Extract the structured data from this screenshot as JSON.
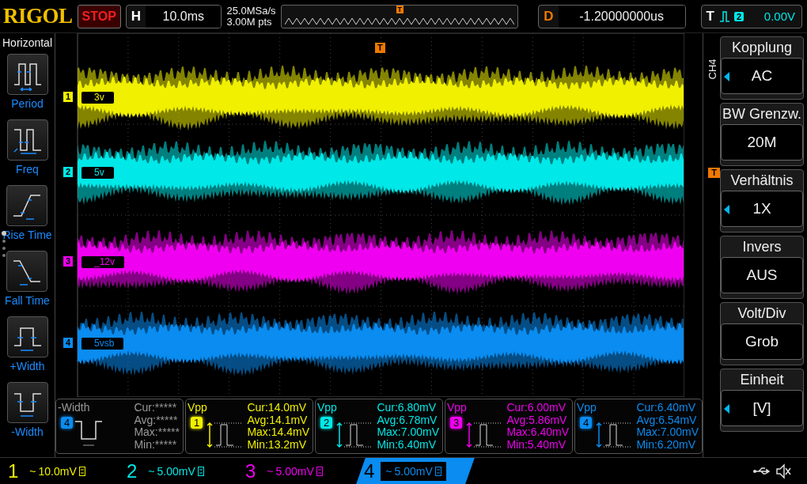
{
  "header": {
    "brand": "RIGOL",
    "run_state": "STOP",
    "timebase": {
      "label": "H",
      "value": "10.0ms"
    },
    "sample_rate": "25.0MSa/s",
    "memory_depth": "3.00M pts",
    "position_marker": "T",
    "delay": {
      "label": "D",
      "value": "-1.20000000us"
    },
    "trigger": {
      "label": "T",
      "source": "2",
      "level": "0.00V"
    }
  },
  "left_menu": {
    "title": "Horizontal",
    "items": [
      {
        "label": "Period",
        "kind": "period"
      },
      {
        "label": "Freq",
        "kind": "freq"
      },
      {
        "label": "Rise Time",
        "kind": "rise"
      },
      {
        "label": "Fall Time",
        "kind": "fall"
      },
      {
        "label": "+Width",
        "kind": "pwidth"
      },
      {
        "label": "-Width",
        "kind": "nwidth"
      }
    ]
  },
  "scope": {
    "trigger_position_marker": "T",
    "trigger_level_marker": "T",
    "channels": [
      {
        "number": "1",
        "label": "3v",
        "color": "#f0f000"
      },
      {
        "number": "2",
        "label": "5v",
        "color": "#00e8e8"
      },
      {
        "number": "3",
        "label": "_12v",
        "color": "#f000f0"
      },
      {
        "number": "4",
        "label": "5vsb",
        "color": "#0a8cf0"
      }
    ]
  },
  "right_menu": {
    "channel": "CH4",
    "items": [
      {
        "title": "Kopplung",
        "value": "AC",
        "arrow": true
      },
      {
        "title": "BW Grenzw.",
        "value": "20M",
        "arrow": false
      },
      {
        "title": "Verhältnis",
        "value": "1X",
        "arrow": true
      },
      {
        "title": "Invers",
        "value": "AUS",
        "arrow": false
      },
      {
        "title": "Volt/Div",
        "value": "Grob",
        "arrow": false
      },
      {
        "title": "Einheit",
        "value": "[V]",
        "arrow": true
      }
    ]
  },
  "measurements": [
    {
      "kind": "width",
      "title": "-Width",
      "channel": "4",
      "color": "#0a8cf0",
      "lines": [
        "Cur:*****",
        "Avg:*****",
        "Max:*****",
        "Min:*****"
      ]
    },
    {
      "kind": "vpp",
      "title": "Vpp",
      "channel": "1",
      "color": "#f0f000",
      "lines": [
        "Cur:14.0mV",
        "Avg:14.1mV",
        "Max:14.4mV",
        "Min:13.2mV"
      ]
    },
    {
      "kind": "vpp",
      "title": "Vpp",
      "channel": "2",
      "color": "#00e8e8",
      "lines": [
        "Cur:6.80mV",
        "Avg:6.78mV",
        "Max:7.00mV",
        "Min:6.40mV"
      ]
    },
    {
      "kind": "vpp",
      "title": "Vpp",
      "channel": "3",
      "color": "#f000f0",
      "lines": [
        "Cur:6.00mV",
        "Avg:5.86mV",
        "Max:6.40mV",
        "Min:5.40mV"
      ]
    },
    {
      "kind": "vpp",
      "title": "Vpp",
      "channel": "4",
      "color": "#0a8cf0",
      "lines": [
        "Cur:6.40mV",
        "Avg:6.54mV",
        "Max:7.00mV",
        "Min:6.20mV"
      ]
    }
  ],
  "bottom_bar": {
    "channels": [
      {
        "number": "1",
        "coupling": "~",
        "scale": "10.0mV",
        "color": "#f0f000",
        "selected": false
      },
      {
        "number": "2",
        "coupling": "~",
        "scale": "5.00mV",
        "color": "#00e8e8",
        "selected": false
      },
      {
        "number": "3",
        "coupling": "~",
        "scale": "5.00mV",
        "color": "#f000f0",
        "selected": false
      },
      {
        "number": "4",
        "coupling": "~",
        "scale": "5.00mV",
        "color": "#0a8cf0",
        "selected": true
      }
    ]
  }
}
